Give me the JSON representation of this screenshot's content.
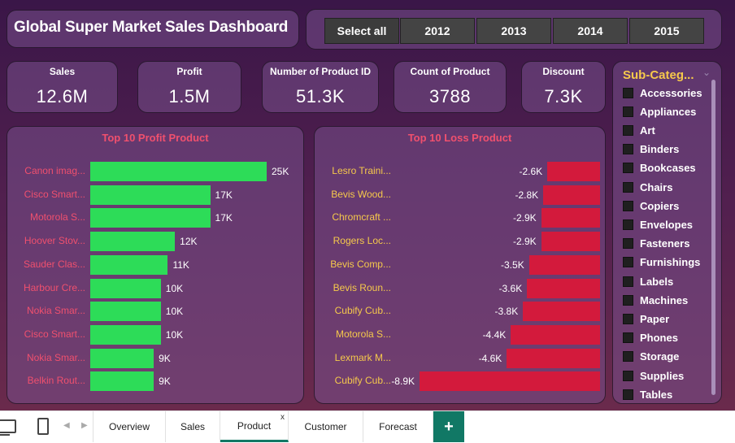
{
  "dashboard": {
    "title": "Global Super Market Sales Dashboard"
  },
  "year_slicer": {
    "buttons": [
      "Select all",
      "2012",
      "2013",
      "2014",
      "2015"
    ],
    "selected": "Select all"
  },
  "kpis": [
    {
      "label": "Sales",
      "value": "12.6M"
    },
    {
      "label": "Profit",
      "value": "1.5M"
    },
    {
      "label": "Number of Product ID",
      "value": "51.3K"
    },
    {
      "label": "Count of Product",
      "value": "3788"
    },
    {
      "label": "Discount",
      "value": "7.3K"
    }
  ],
  "chart_data": [
    {
      "type": "bar",
      "orientation": "horizontal",
      "title": "Top 10 Profit Product",
      "categories": [
        "Canon imag...",
        "Cisco Smart...",
        "Motorola S...",
        "Hoover Stov...",
        "Sauder Clas...",
        "Harbour Cre...",
        "Nokia Smar...",
        "Cisco Smart...",
        "Nokia Smar...",
        "Belkin Rout..."
      ],
      "values": [
        25000,
        17000,
        17000,
        12000,
        11000,
        10000,
        10000,
        10000,
        9000,
        9000
      ],
      "data_labels": [
        "25K",
        "17K",
        "17K",
        "12K",
        "11K",
        "10K",
        "10K",
        "10K",
        "9K",
        "9K"
      ],
      "color": "#2ddc58",
      "category_color": "#f0506e",
      "xlim": [
        0,
        25000
      ]
    },
    {
      "type": "bar",
      "orientation": "horizontal",
      "title": "Top 10 Loss Product",
      "categories": [
        "Lesro Traini...",
        "Bevis Wood...",
        "Chromcraft ...",
        "Rogers Loc...",
        "Bevis Comp...",
        "Bevis Roun...",
        "Cubify Cub...",
        "Motorola S...",
        "Lexmark M...",
        "Cubify Cub..."
      ],
      "values": [
        -2600,
        -2800,
        -2900,
        -2900,
        -3500,
        -3600,
        -3800,
        -4400,
        -4600,
        -8900
      ],
      "data_labels": [
        "-2.6K",
        "-2.8K",
        "-2.9K",
        "-2.9K",
        "-3.5K",
        "-3.6K",
        "-3.8K",
        "-4.4K",
        "-4.6K",
        "-8.9K"
      ],
      "color": "#d31a3c",
      "category_color": "#f6c94b",
      "xlim": [
        -8900,
        0
      ]
    }
  ],
  "subcategory_slicer": {
    "title": "Sub-Categ...",
    "items": [
      "Accessories",
      "Appliances",
      "Art",
      "Binders",
      "Bookcases",
      "Chairs",
      "Copiers",
      "Envelopes",
      "Fasteners",
      "Furnishings",
      "Labels",
      "Machines",
      "Paper",
      "Phones",
      "Storage",
      "Supplies",
      "Tables"
    ]
  },
  "page_tabs": {
    "tabs": [
      "Overview",
      "Sales",
      "Product",
      "Customer",
      "Forecast"
    ],
    "active": "Product",
    "close_glyph": "x",
    "add_glyph": "+"
  },
  "colors": {
    "accent": "#117865",
    "profit_bar": "#2ddc58",
    "loss_bar": "#d31a3c",
    "chart_title": "#f0506e",
    "slicer_title": "#f6c94b"
  }
}
